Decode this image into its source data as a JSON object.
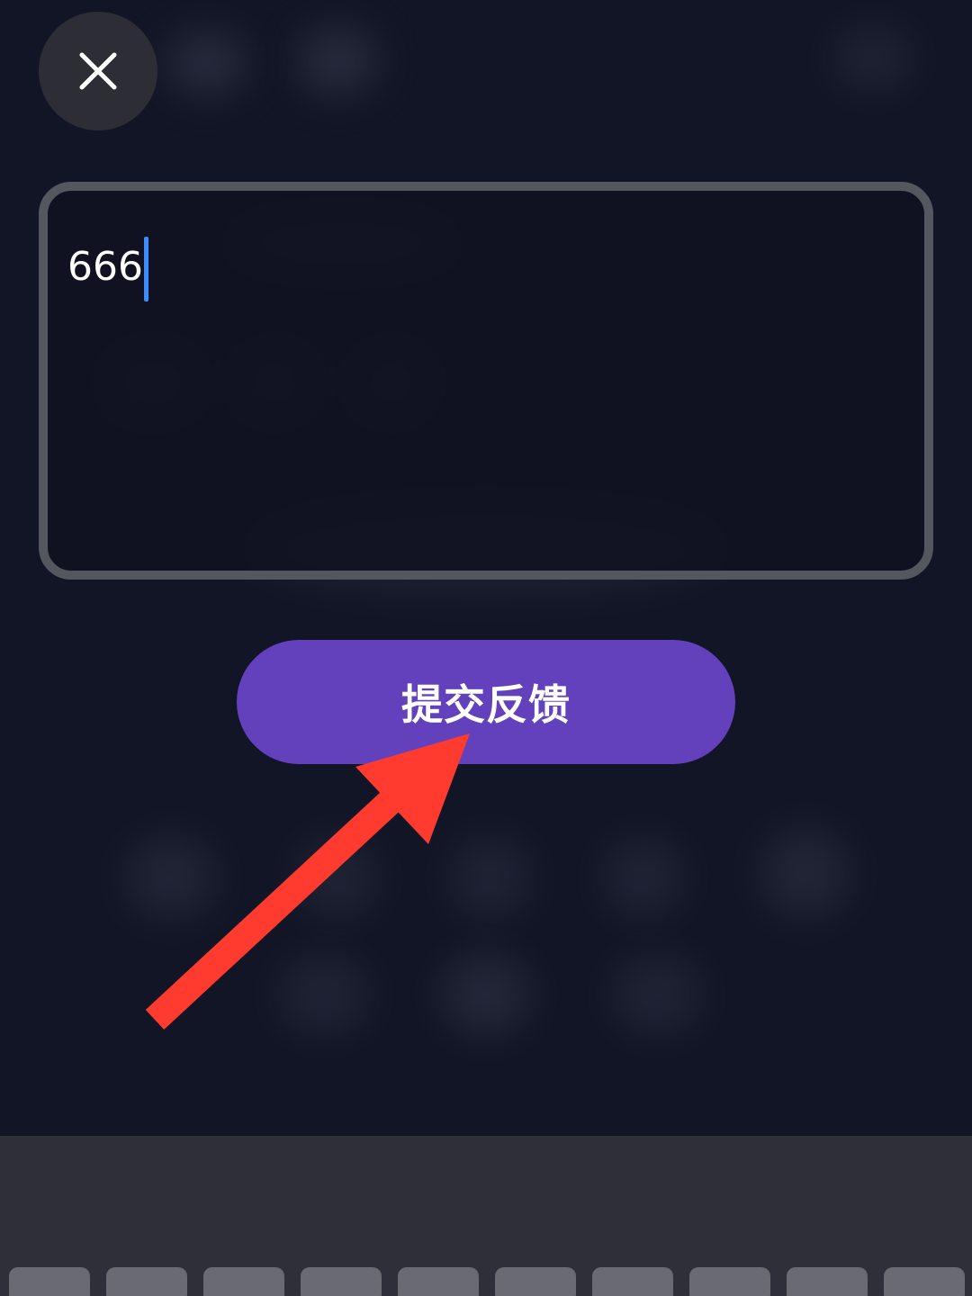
{
  "window": {
    "accent_color": "#6341bd",
    "background_color": "#121526",
    "annotation_color": "#ff3b30"
  },
  "header": {
    "close_icon": "close-icon"
  },
  "feedback": {
    "value": "666",
    "cursor_color": "#3b8cff"
  },
  "submit": {
    "label": "提交反馈"
  },
  "annotation": {
    "icon": "red-arrow-icon"
  },
  "keyboard": {
    "key_count": 10
  }
}
